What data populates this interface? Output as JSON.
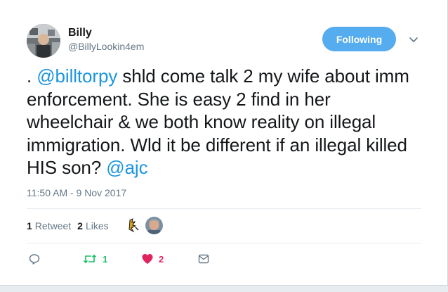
{
  "user": {
    "name": "Billy",
    "handle": "@BillyLookin4em"
  },
  "follow_button": {
    "label": "Following"
  },
  "tweet": {
    "text_parts": [
      {
        "text": ". ",
        "type": "text"
      },
      {
        "text": "@billtorpy",
        "type": "mention"
      },
      {
        "text": " shld come talk 2 my wife about imm enforcement. She is easy 2 find in her wheelchair & we both know reality on illegal immigration. Wld it be different if an illegal killed HIS son? ",
        "type": "text"
      },
      {
        "text": "@ajc",
        "type": "mention"
      }
    ],
    "timestamp": "11:50 AM - 9 Nov 2017"
  },
  "stats": {
    "retweets_count": "1",
    "retweets_label": "Retweet",
    "likes_count": "2",
    "likes_label": "Likes"
  },
  "actions": {
    "reply_icon": "reply-icon",
    "retweet_icon": "retweet-icon",
    "retweet_count": "1",
    "like_icon": "heart-icon",
    "like_count": "2",
    "dm_icon": "envelope-icon"
  },
  "colors": {
    "accent": "#1b95e0",
    "button": "#55acee",
    "retweet_green": "#17bf63",
    "like_red": "#e0245e",
    "muted": "#657786"
  }
}
